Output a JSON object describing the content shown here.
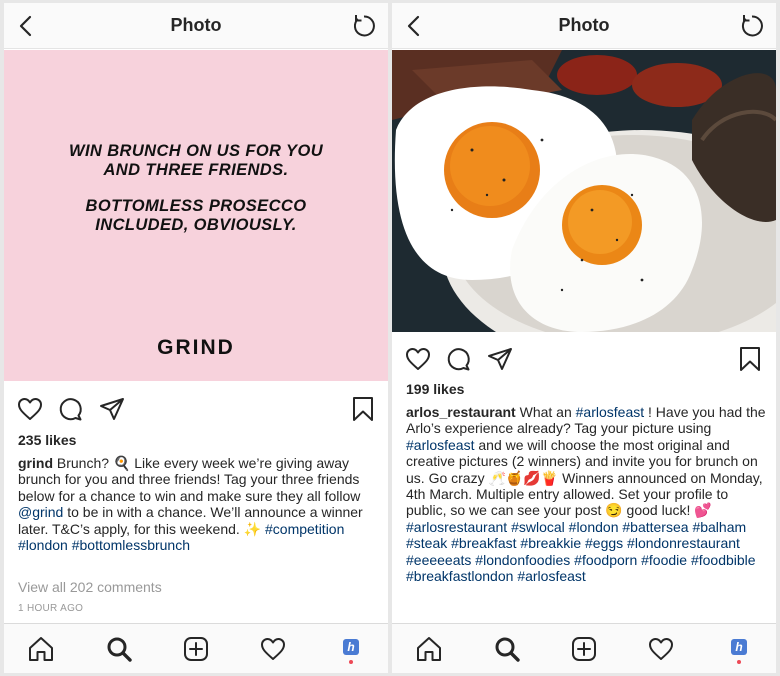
{
  "left": {
    "header": {
      "title": "Photo"
    },
    "post_image": {
      "lines_block1": [
        "WIN BRUNCH ON US FOR YOU",
        "AND THREE FRIENDS."
      ],
      "lines_block2": [
        "BOTTOMLESS PROSECCO",
        "INCLUDED, OBVIOUSLY."
      ],
      "brand": "GRIND",
      "bg_color": "#f7d2dc"
    },
    "likes": "235 likes",
    "caption": {
      "username": "grind",
      "seg1": " Brunch? ",
      "emoji1": "🍳",
      "seg2": " Like every week we’re giving away brunch for you and three friends! Tag your three friends below for a chance to win and make sure they all follow ",
      "mention": "@grind",
      "seg3": " to be in with a chance. We’ll announce a winner later. T&C’s apply, for this weekend. ",
      "emoji2": "✨",
      "tags": [
        "#competition",
        "#london",
        "#bottomlessbrunch"
      ]
    },
    "view_all": "View all 202 comments",
    "time_ago": "1 HOUR AGO"
  },
  "right": {
    "header": {
      "title": "Photo"
    },
    "likes": "199 likes",
    "caption": {
      "username": "arlos_restaurant",
      "seg1": " What an ",
      "tag1": "#arlosfeast",
      "seg2": " ! Have you had the Arlo’s experience already? Tag your picture using ",
      "tag2": "#arlosfeast",
      "seg3": " and we will choose the most original and creative pictures (2 winners) and invite you for brunch on us. Go crazy ",
      "emojis1": "🥂🍯💋🍟",
      "seg4": " Winners announced on Monday, 4th March. Multiple entry allowed. Set your profile to public, so we can see your post ",
      "emoji2": "😏",
      "seg5": " good luck! ",
      "emoji3": "💕",
      "tags": [
        "#arlosrestaurant",
        "#swlocal",
        "#london",
        "#battersea",
        "#balham",
        "#steak",
        "#breakfast",
        "#breakkie",
        "#eggs",
        "#londonrestaurant",
        "#eeeeeats",
        "#londonfoodies",
        "#foodporn",
        "#foodie",
        "#foodbible",
        "#breakfastlondon",
        "#arlosfeast"
      ]
    }
  },
  "tabbar": {
    "profile_letter": "h",
    "notification_color": "#ed4956"
  },
  "colors": {
    "hashtag": "#003569",
    "muted": "#999999",
    "text": "#262626"
  }
}
